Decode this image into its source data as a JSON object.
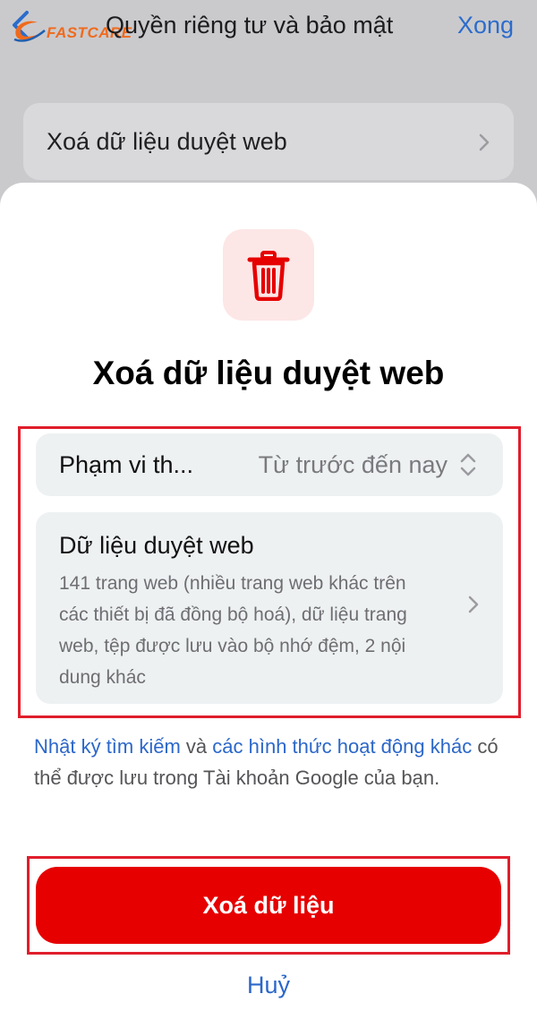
{
  "nav": {
    "title": "Quyền riêng tư và bảo mật",
    "done_label": "Xong",
    "logo_text": "FASTCARE"
  },
  "background_row": {
    "label": "Xoá dữ liệu duyệt web"
  },
  "sheet": {
    "icon": "trash-icon",
    "title": "Xoá dữ liệu duyệt web",
    "time_range": {
      "label": "Phạm vi th...",
      "value": "Từ trước đến nay"
    },
    "browsing_data": {
      "title": "Dữ liệu duyệt web",
      "description": "141 trang web (nhiều trang web khác trên các thiết bị đã đồng bộ hoá), dữ liệu trang web, tệp được lưu vào bộ nhớ đệm, 2 nội dung khác"
    },
    "note": {
      "link1": "Nhật ký tìm kiếm",
      "text1": " và ",
      "link2": "các hình thức hoạt động khác",
      "text2": " có thể được lưu trong Tài khoản Google của bạn."
    },
    "primary_button": "Xoá dữ liệu",
    "cancel_button": "Huỷ"
  },
  "colors": {
    "accent_blue": "#2b67c9",
    "destructive_red": "#e60000",
    "highlight_box": "#e01e2b"
  }
}
